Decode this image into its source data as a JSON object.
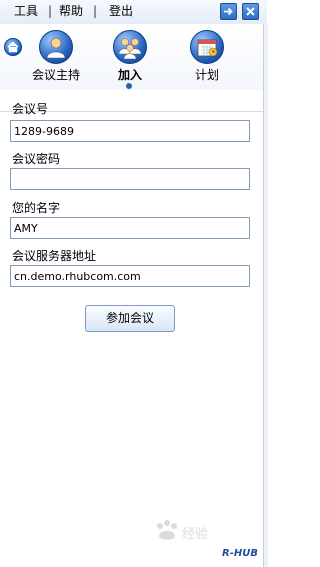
{
  "menu": {
    "tools": "工具",
    "help": "帮助",
    "logout": "登出",
    "separator": "|"
  },
  "tabs": [
    {
      "label": "会议主持",
      "icon": "host-meeting-icon",
      "active": false
    },
    {
      "label": "加入",
      "icon": "join-meeting-icon",
      "active": true
    },
    {
      "label": "计划",
      "icon": "schedule-calendar-icon",
      "active": false
    }
  ],
  "form": {
    "meeting_id_label": "会议号",
    "meeting_id_value": "1289-9689",
    "password_label": "会议密码",
    "password_value": "",
    "name_label": "您的名字",
    "name_value": "AMY",
    "server_label": "会议服务器地址",
    "server_value": "cn.demo.rhubcom.com",
    "join_button": "参加会议"
  },
  "brand": {
    "logo_text": "R-HUB",
    "watermark": "Baidu经验"
  },
  "colors": {
    "accent": "#2461b5",
    "field_border": "#7f9db9"
  }
}
